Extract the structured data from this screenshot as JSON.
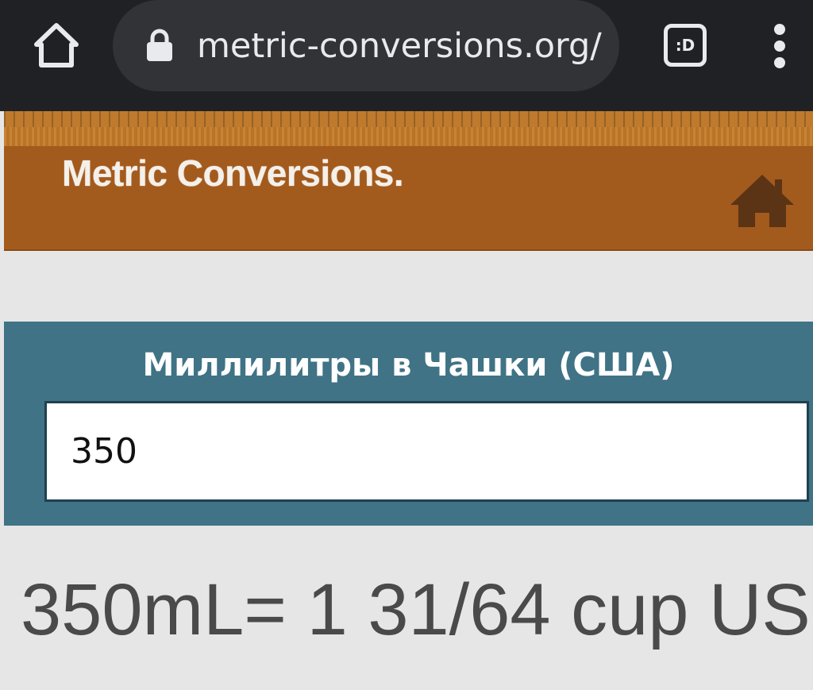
{
  "browser": {
    "url": "metric-conversions.org/r",
    "tab_switcher_label": ":D",
    "icons": {
      "home": "home-icon",
      "lock": "lock-icon",
      "tabs": "tab-switcher-icon",
      "menu": "more-vert-icon"
    }
  },
  "site": {
    "logo_text": "Metric Conversions.",
    "home_icon": "house-icon",
    "header_color": "#a35a1d",
    "ruler_color": "#bf7a2e"
  },
  "converter": {
    "title": "Миллилитры в Чашки (США)",
    "input_value": "350",
    "panel_color": "#3f7385"
  },
  "result": {
    "text": "350mL= 1 31/64 cup US"
  }
}
